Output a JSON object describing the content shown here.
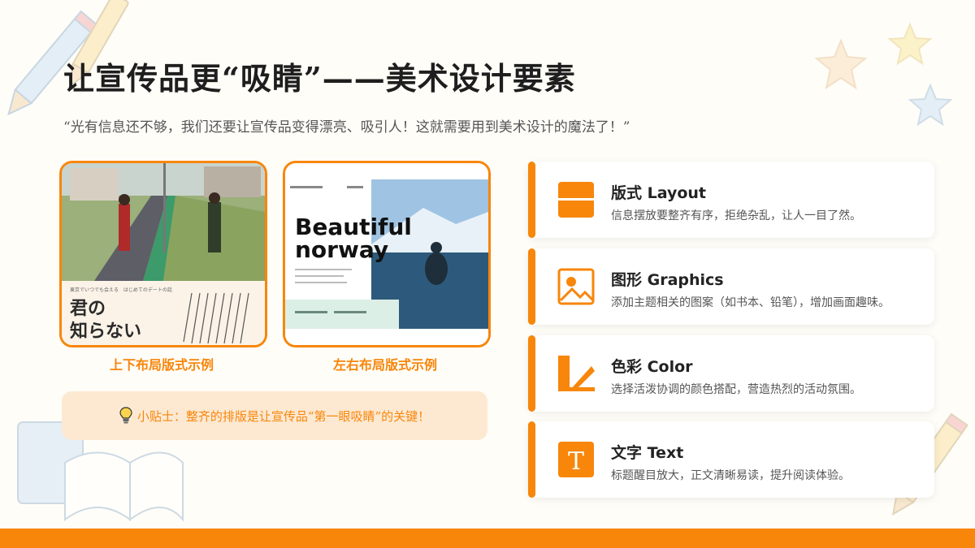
{
  "title": "让宣传品更“吸睛”——美术设计要素",
  "subtitle": "“光有信息还不够，我们还要让宣传品变得漂亮、吸引人！这就需要用到美术设计的魔法了！”",
  "examples": [
    {
      "caption": "上下布局版式示例",
      "poster_heading": "君の\n知らない",
      "poster_small": "東京でいつでも会える　はじめてのデートの話"
    },
    {
      "caption": "左右布局版式示例",
      "poster_heading_1": "Beautiful",
      "poster_heading_2": "norway"
    }
  ],
  "tip": "小贴士：整齐的排版是让宣传品“第一眼吸睛”的关键！",
  "features": [
    {
      "name": "版式 Layout",
      "desc": "信息摆放要整齐有序，拒绝杂乱，让人一目了然。",
      "icon": "layout-icon"
    },
    {
      "name": "图形 Graphics",
      "desc": "添加主题相关的图案（如书本、铅笔），增加画面趣味。",
      "icon": "image-icon"
    },
    {
      "name": "色彩 Color",
      "desc": "选择活泼协调的颜色搭配，营造热烈的活动氛围。",
      "icon": "color-icon"
    },
    {
      "name": "文字 Text",
      "desc": "标题醒目放大，正文清晰易读，提升阅读体验。",
      "icon": "text-icon"
    }
  ],
  "colors": {
    "accent": "#f7860b",
    "tip_bg": "#fde9d2",
    "background": "#fffdf8"
  }
}
